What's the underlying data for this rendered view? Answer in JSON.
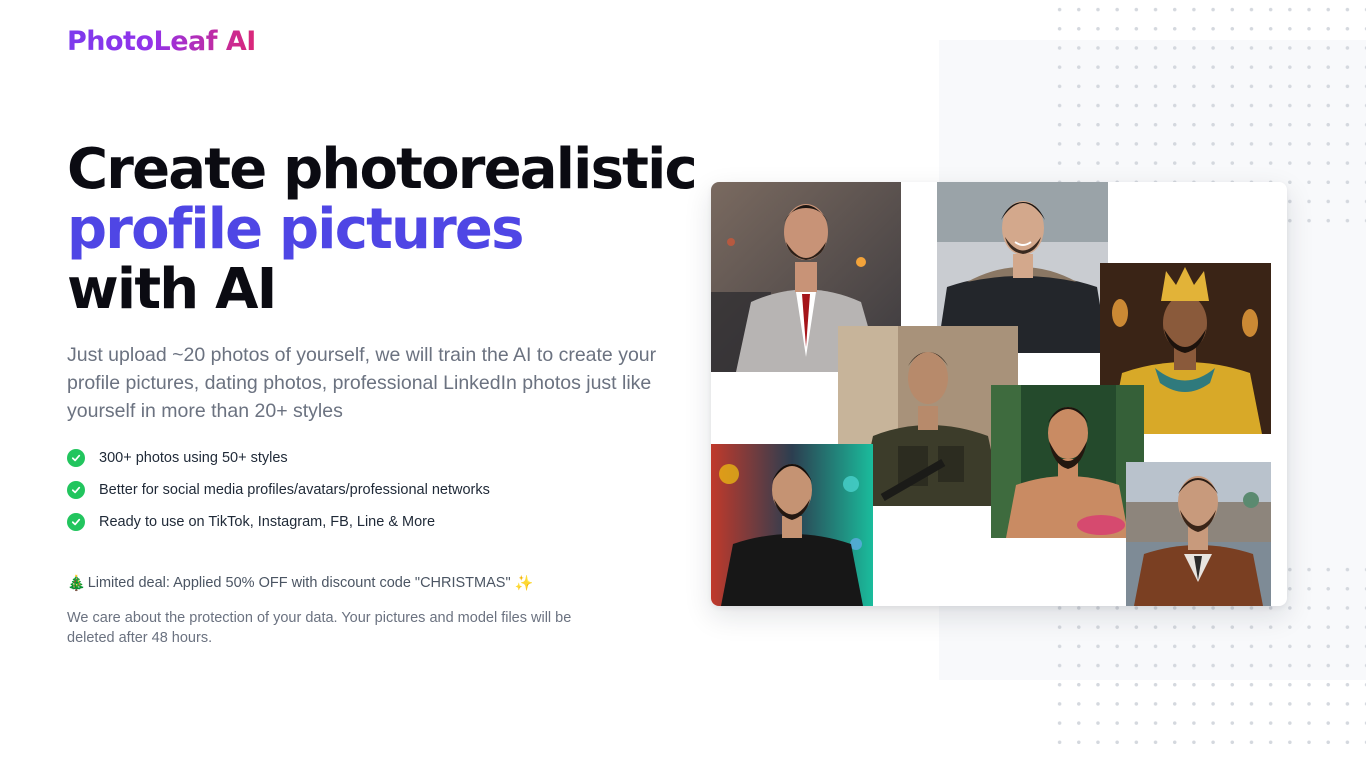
{
  "brand": {
    "logo_text": "PhotoLeaf AI"
  },
  "hero": {
    "headline_line1": "Create photorealistic",
    "headline_line2": "profile pictures",
    "headline_line3": "with AI",
    "subtitle": "Just upload ~20 photos of yourself, we will train the AI to create your profile pictures, dating photos, professional LinkedIn photos just like yourself in more than 20+ styles"
  },
  "features": [
    {
      "text": "300+ photos using 50+ styles",
      "icon": "check-circle-icon"
    },
    {
      "text": "Better for social media profiles/avatars/professional networks",
      "icon": "check-circle-icon"
    },
    {
      "text": "Ready to use on TikTok, Instagram, FB, Line & More",
      "icon": "check-circle-icon"
    }
  ],
  "deal": {
    "prefix_icon": "🎄",
    "text": "Limited deal: Applied 50% OFF with discount code \"CHRISTMAS\"",
    "suffix_icon": "✨"
  },
  "privacy_note": "We care about the protection of your data. Your pictures and model files will be deleted after 48 hours.",
  "collage": {
    "photos": [
      {
        "subject": "man-in-checked-suit-red-tie"
      },
      {
        "subject": "smiling-man-in-winter-parka"
      },
      {
        "subject": "man-wearing-golden-crown"
      },
      {
        "subject": "soldier-in-tactical-gear"
      },
      {
        "subject": "bearded-man-in-forest"
      },
      {
        "subject": "man-in-leather-jacket-city-lights"
      },
      {
        "subject": "man-in-brown-coat-city-river"
      }
    ]
  },
  "colors": {
    "accent": "#4f46e5",
    "logo_gradient_start": "#7c3aed",
    "logo_gradient_end": "#db2777",
    "check": "#22c55e"
  }
}
